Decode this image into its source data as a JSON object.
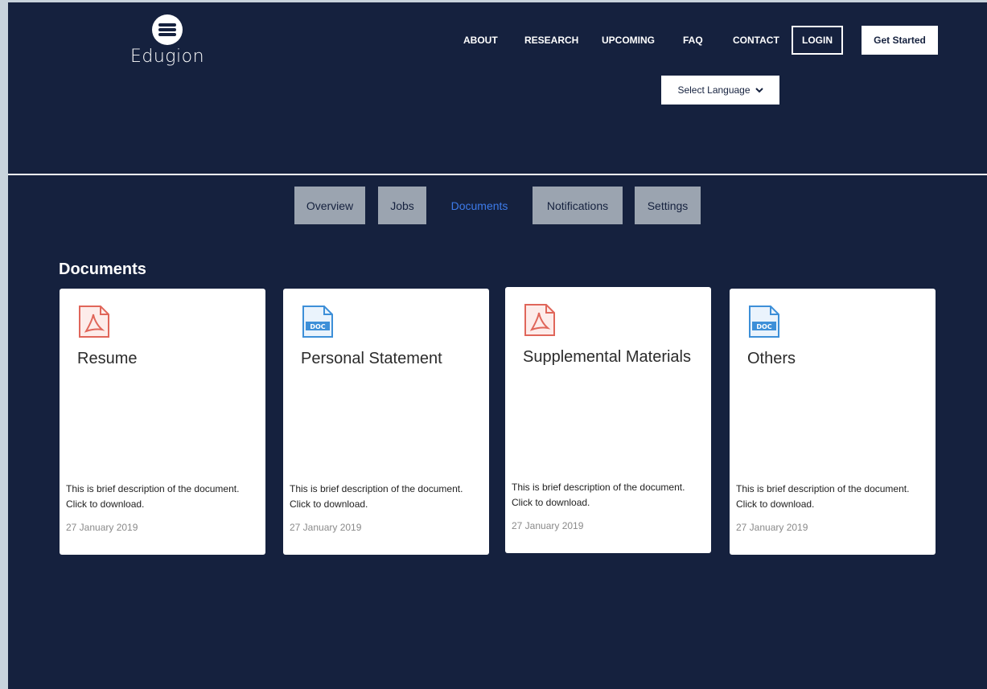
{
  "header": {
    "logo_text": "Edugion",
    "nav": [
      "ABOUT",
      "RESEARCH",
      "UPCOMING",
      "FAQ",
      "CONTACT"
    ],
    "login_label": "LOGIN",
    "get_started_label": "Get Started",
    "language_label": "Select Language",
    "language_icon": "chevron-down-icon"
  },
  "tabs": [
    {
      "label": "Overview",
      "active": false
    },
    {
      "label": "Jobs",
      "active": false
    },
    {
      "label": "Documents",
      "active": true
    },
    {
      "label": "Notifications",
      "active": false
    },
    {
      "label": "Settings",
      "active": false
    }
  ],
  "section": {
    "title": "Documents"
  },
  "documents": [
    {
      "icon": "pdf-icon",
      "title": "Resume",
      "description": "This is brief description of the document. Click to download.",
      "date": "27 January 2019"
    },
    {
      "icon": "doc-icon",
      "title": "Personal Statement",
      "description": "This is brief description of the document. Click to download.",
      "date": "27 January 2019"
    },
    {
      "icon": "pdf-icon",
      "title": "Supplemental Materials",
      "description": "This is brief description of the document. Click to download.",
      "date": "27 January 2019"
    },
    {
      "icon": "doc-icon",
      "title": "Others",
      "description": "This is brief description of the document. Click to download.",
      "date": "27 January 2019"
    }
  ],
  "colors": {
    "background": "#15213e",
    "tab_inactive": "#9ba4b0",
    "tab_active_text": "#3d7bea",
    "pdf_icon": "#e0665a",
    "doc_icon": "#3d8fd8"
  }
}
